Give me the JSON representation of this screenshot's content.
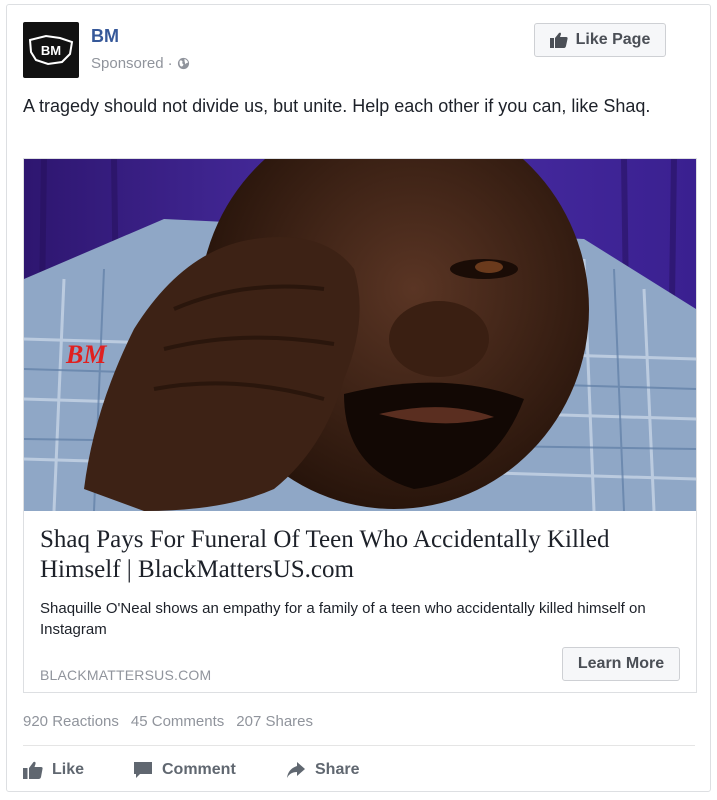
{
  "post": {
    "page_name": "BM",
    "avatar_text": "BM",
    "sponsored_label": "Sponsored",
    "separator": "·",
    "like_page_label": "Like Page",
    "message": "A tragedy should not divide us, but unite. Help each other if you can, like Shaq."
  },
  "attachment": {
    "photo_watermark": "BM",
    "headline": "Shaq Pays For Funeral Of Teen Who Accidentally Killed Himself | BlackMattersUS.com",
    "description": "Shaquille O'Neal shows an empathy for a family of a teen who accidentally killed himself on Instagram",
    "domain": "BLACKMATTERSUS.COM",
    "cta_label": "Learn More"
  },
  "stats": {
    "reactions": "920 Reactions",
    "comments": "45 Comments",
    "shares": "207 Shares"
  },
  "actions": {
    "like_label": "Like",
    "comment_label": "Comment",
    "share_label": "Share"
  },
  "icons": {
    "thumbs_up": "thumbs-up-icon",
    "comment": "comment-bubble-icon",
    "share": "share-arrow-icon",
    "globe": "globe-icon"
  },
  "colors": {
    "page_name": "#365899",
    "muted": "#90949c",
    "button_bg": "#f6f7f9",
    "photo_backdrop": "#3f2590"
  }
}
